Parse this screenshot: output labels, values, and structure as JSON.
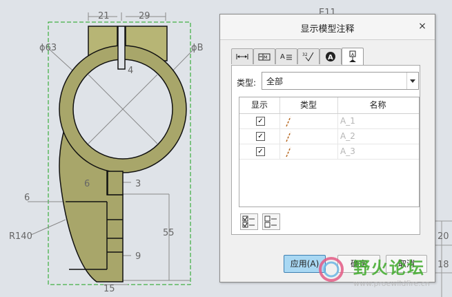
{
  "drawing": {
    "dims": {
      "d21": "21",
      "d29": "29",
      "phi63": "ϕ63",
      "phiB": "ϕB",
      "d4": "4",
      "d6a": "6",
      "d3": "3",
      "d6b": "6",
      "r140": "R140",
      "d55": "55",
      "d9": "9",
      "d15": "15",
      "d20": "20",
      "d18": "18",
      "top_partial": "E11"
    },
    "colors": {
      "part_fill": "#a8a66a",
      "part_edge": "#111111",
      "bbox": "#1aa31a",
      "dimension": "#777777"
    }
  },
  "dialog": {
    "title": "显示模型注释",
    "close_glyph": "×",
    "tabs": [
      "dimension-tab",
      "tolerance-tab",
      "note-tab",
      "surface-finish-tab",
      "symbol-tab",
      "datum-tab"
    ],
    "active_tab": 5,
    "type_label": "类型:",
    "type_value": "全部",
    "grid": {
      "headers": [
        "显示",
        "类型",
        "名称"
      ],
      "rows": [
        {
          "checked": true,
          "name": "A_1"
        },
        {
          "checked": true,
          "name": "A_2"
        },
        {
          "checked": true,
          "name": "A_3"
        }
      ]
    },
    "buttons": {
      "apply": "应用(A)",
      "ok": "确定",
      "cancel": "取消"
    }
  },
  "watermark": {
    "text": "野火论坛",
    "url": "www.proewildfire.cn"
  }
}
